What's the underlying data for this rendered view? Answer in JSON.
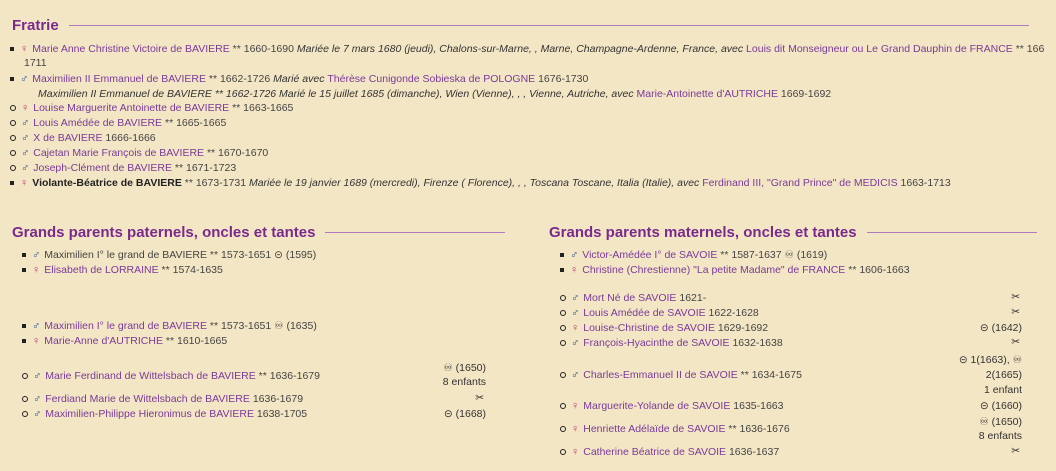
{
  "fratrie": {
    "title": "Fratrie",
    "items": [
      {
        "sym": "♀",
        "name": "Marie Anne Christine Victoire de BAVIERE",
        "tail": " ** 1660-1690 ",
        "note": "Mariée le 7 mars 1680 (jeudi), Chalons-sur-Marne, , Marne, Champagne-Ardenne, France, avec ",
        "spouse": "Louis dit Monseigneur ou Le Grand Dauphin de FRANCE",
        "after": " ** 166",
        "wrap": "1711"
      },
      {
        "sym": "♂",
        "name": "Maximilien II Emmanuel de BAVIERE",
        "tail": " ** 1662-1726 ",
        "note": "Marié avec ",
        "spouse": "Thérèse Cunigonde Sobieska de POLOGNE",
        "after": " 1676-1730"
      },
      {
        "line2": "Maximilien II Emmanuel de BAVIERE ** 1662-1726 Marié le 15 juillet 1685 (dimanche), Wien (Vienne), , , Vienne, Autriche, avec ",
        "spouse2": "Marie-Antoinette d'AUTRICHE",
        "after2": " 1669-1692"
      },
      {
        "sym": "♀",
        "name": "Louise Marguerite Antoinette de BAVIERE",
        "tail": " ** 1663-1665"
      },
      {
        "sym": "♂",
        "name": "Louis Amédée de BAVIERE",
        "tail": " ** 1665-1665"
      },
      {
        "sym": "♂",
        "name": "X de BAVIERE",
        "tail": " 1666-1666"
      },
      {
        "sym": "♂",
        "name": "Cajetan Marie François de BAVIERE",
        "tail": " ** 1670-1670"
      },
      {
        "sym": "♂",
        "name": "Joseph-Clément de BAVIERE",
        "tail": " ** 1671-1723"
      },
      {
        "sym": "♀",
        "name": "Violante-Béatrice de BAVIERE",
        "tail": " ** 1673-1731 ",
        "note": "Mariée le 19 janvier 1689 (mercredi), Firenze ( Florence), , , Toscana Toscane, Italia (Italie), avec ",
        "spouse": "Ferdinand III, \"Grand Prince\" de MEDICIS",
        "after": " 1663-1713"
      }
    ]
  },
  "paternal": {
    "title": "Grands parents paternels, oncles et tantes",
    "items": [
      {
        "sym": "♂",
        "name": "Maximilien I° le grand de BAVIERE",
        "tail": " ** 1573-1651 ",
        "mark": "⊝ (1595)"
      },
      {
        "sym": "♀",
        "name": "Elisabeth de LORRAINE",
        "tail": " ** 1574-1635"
      },
      {
        "sym": "♂",
        "name": "Maximilien I° le grand de BAVIERE",
        "tail": " ** 1573-1651 ",
        "mark": "♾ (1635)"
      },
      {
        "sym": "♀",
        "name": "Marie-Anne d'AUTRICHE",
        "tail": " ** 1610-1665"
      },
      {
        "sym": "♂",
        "name": "Marie Ferdinand de Wittelsbach de BAVIERE",
        "tail": " ** 1636-1679",
        "right1": "♾ (1650)",
        "right2": "8 enfants"
      },
      {
        "sym": "♂",
        "name": "Ferdiand Marie de Wittelsbach de BAVIERE",
        "tail": " 1636-1679",
        "right1": "✂"
      },
      {
        "sym": "♂",
        "name": "Maximilien-Philippe Hieronimus de BAVIERE",
        "tail": " 1638-1705",
        "right1": "⊝ (1668)"
      }
    ]
  },
  "maternal": {
    "title": "Grands parents maternels, oncles et tantes",
    "items": [
      {
        "sym": "♂",
        "name": "Victor-Amédée I° de SAVOIE",
        "tail": " ** 1587-1637 ",
        "mark": "♾ (1619)"
      },
      {
        "sym": "♀",
        "name": "Christine (Chrestienne) \"La petite Madame\" de FRANCE",
        "tail": " ** 1606-1663"
      },
      {
        "sym": "♂",
        "name": "Mort Né de SAVOIE",
        "tail": " 1621-",
        "right1": "✂"
      },
      {
        "sym": "♂",
        "name": "Louis Amédée de SAVOIE",
        "tail": " 1622-1628",
        "right1": "✂"
      },
      {
        "sym": "♀",
        "name": "Louise-Christine de SAVOIE",
        "tail": " 1629-1692",
        "right1": "⊝ (1642)"
      },
      {
        "sym": "♂",
        "name": "François-Hyacinthe de SAVOIE",
        "tail": " 1632-1638",
        "right1": "✂"
      },
      {
        "sym": "♂",
        "name": "Charles-Emmanuel II de SAVOIE",
        "tail": " ** 1634-1675",
        "right0": "⊝ 1(1663), ♾",
        "right1": "2(1665)",
        "right2": "1 enfant"
      },
      {
        "sym": "♀",
        "name": "Marguerite-Yolande de SAVOIE",
        "tail": " 1635-1663",
        "right1": "⊝ (1660)"
      },
      {
        "sym": "♀",
        "name": "Henriette Adélaïde de SAVOIE",
        "tail": " ** 1636-1676",
        "right1": "♾ (1650)",
        "right2": "8 enfants"
      },
      {
        "sym": "♀",
        "name": "Catherine Béatrice de SAVOIE",
        "tail": " 1636-1637",
        "right1": "✂"
      }
    ]
  }
}
